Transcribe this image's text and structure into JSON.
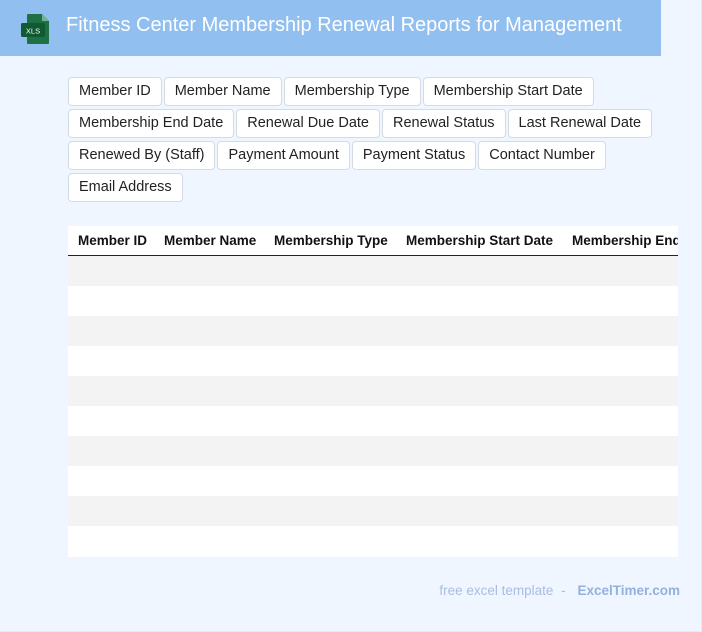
{
  "header": {
    "icon_label": "XLS",
    "title": "Fitness Center Membership Renewal Reports for Management",
    "colors": {
      "bar": "#90bff0",
      "icon": "#1e7145"
    }
  },
  "fields": [
    "Member ID",
    "Member Name",
    "Membership Type",
    "Membership Start Date",
    "Membership End Date",
    "Renewal Due Date",
    "Renewal Status",
    "Last Renewal Date",
    "Renewed By (Staff)",
    "Payment Amount",
    "Payment Status",
    "Contact Number",
    "Email Address"
  ],
  "table": {
    "columns": [
      "Member ID",
      "Member Name",
      "Membership Type",
      "Membership Start Date",
      "Membership End Date"
    ],
    "rows": [
      [],
      [],
      [],
      [],
      [],
      [],
      [],
      [],
      [],
      []
    ]
  },
  "footer": {
    "free_text": "free excel template",
    "separator": "-",
    "brand": "ExcelTimer.com"
  }
}
